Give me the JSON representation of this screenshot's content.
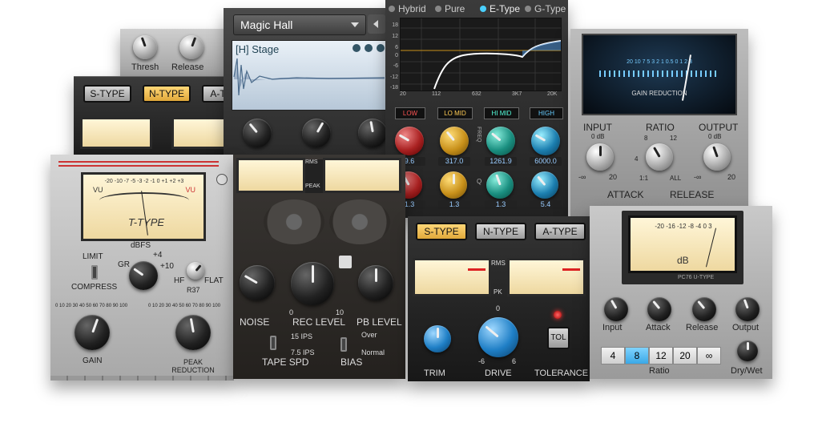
{
  "hall": {
    "preset": "Magic Hall",
    "sub_preset": "[H] Stage"
  },
  "comp_top": {
    "labels": [
      "Thresh",
      "Release"
    ]
  },
  "type_buttons_back": [
    "S-TYPE",
    "N-TYPE",
    "A-T"
  ],
  "eq": {
    "modes": [
      "Hybrid",
      "Pure",
      "E-Type",
      "G-Type"
    ],
    "db_ticks": [
      "18",
      "12",
      "6",
      "0",
      "-6",
      "-12",
      "-18"
    ],
    "freq_ticks": [
      "20",
      "112",
      "632",
      "3K7",
      "20K"
    ],
    "bands": [
      "LOW",
      "LO MID",
      "HI MID",
      "HIGH"
    ],
    "freq_label": "FREQ",
    "q_label": "Q",
    "values_top": [
      "9.6",
      "317.0",
      "1261.9",
      "6000.0"
    ],
    "values_bottom": [
      "1.3",
      "1.3",
      "1.3",
      "5.4"
    ]
  },
  "gr": {
    "title": "GAIN REDUCTION",
    "scale": "20 10 7 5 3 2 1 0.5 0 1 2 3",
    "input_label": "INPUT",
    "input_db": "0 dB",
    "ratio_label": "RATIO",
    "ratio_marks": [
      "8",
      "12",
      "4",
      "1:1",
      "ALL"
    ],
    "output_label": "OUTPUT",
    "output_db": "0 dB",
    "inf": "-∞",
    "twenty": "20",
    "attack": "ATTACK",
    "release": "RELEASE"
  },
  "ttype": {
    "vu_left": "VU",
    "vu_right": "VU",
    "vu_scale": "-20 -10 -7 -5 -3 -2 -1 0 +1 +2 +3",
    "name": "T-TYPE",
    "limit": "LIMIT",
    "compress": "COMPRESS",
    "dbfs": "dBFS",
    "plus4": "+4",
    "gr": "GR",
    "plus10": "+10",
    "hf": "HF",
    "flat": "FLAT",
    "r37": "R37",
    "gain_scale": "0 10 20 30 40 50 60 70 80 90 100",
    "gain": "GAIN",
    "peak_reduction": "PEAK REDUCTION"
  },
  "tape": {
    "rms": "RMS",
    "peak": "PEAK",
    "noise": "NOISE",
    "rec_level": "REC LEVEL",
    "pb_level": "PB LEVEL",
    "zero": "0",
    "ten": "10",
    "ips15": "15 IPS",
    "ips75": "7.5 IPS",
    "tape_spd": "TAPE SPD",
    "over": "Over",
    "normal": "Normal",
    "bias": "BIAS"
  },
  "ntype": {
    "buttons": [
      "S-TYPE",
      "N-TYPE",
      "A-TYPE"
    ],
    "rms": "RMS",
    "pk": "PK",
    "trim": "TRIM",
    "drive": "DRIVE",
    "tolerance": "TOLERANCE",
    "tol": "TOL",
    "drive_min": "-6",
    "drive_max": "6",
    "drive_zero": "0"
  },
  "pc76": {
    "scale": "-20 -16 -12 -8 -4 0 3",
    "db": "dB",
    "badge": "PC76 U-TYPE",
    "knobs": [
      "Input",
      "Attack",
      "Release",
      "Output"
    ],
    "ratios": [
      "4",
      "8",
      "12",
      "20",
      "∞"
    ],
    "ratio_label": "Ratio",
    "drywet": "Dry/Wet"
  }
}
